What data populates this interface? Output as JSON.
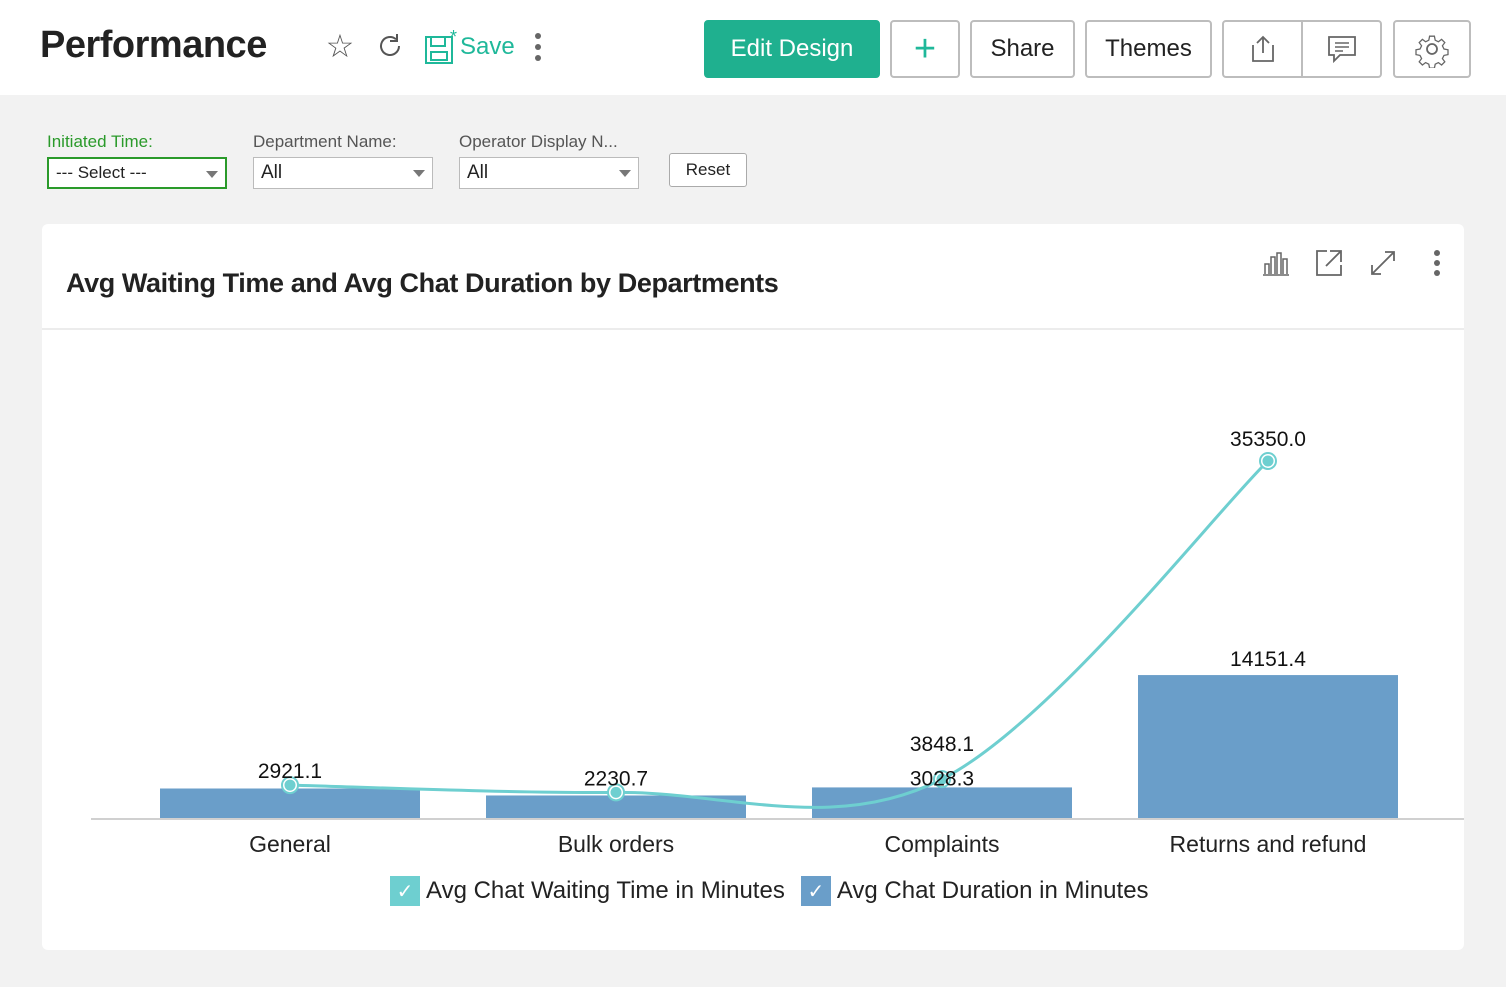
{
  "header": {
    "title": "Performance",
    "save_label": "Save",
    "edit_design_label": "Edit Design",
    "add_label": "+",
    "share_label": "Share",
    "themes_label": "Themes",
    "icons": [
      "star-icon",
      "refresh-icon",
      "save-icon",
      "more-vertical-icon",
      "export-icon",
      "comment-icon",
      "gear-icon"
    ]
  },
  "filters": [
    {
      "label": "Initiated Time:",
      "value": "--- Select ---",
      "active": true
    },
    {
      "label": "Department Name:",
      "value": "All"
    },
    {
      "label": "Operator Display N...",
      "value": "All"
    }
  ],
  "reset_label": "Reset",
  "colors": {
    "accent": "#1fb08f",
    "line_series": "#6ecfd0",
    "bar_series": "#6a9ec9",
    "filter_active": "#2a9a2a"
  },
  "chart_data": {
    "type": "bar",
    "title": "Avg Waiting Time and Avg Chat Duration by Departments",
    "xlabel": "",
    "ylabel": "",
    "categories": [
      "General",
      "Bulk orders",
      "Complaints",
      "Returns and refund"
    ],
    "series": [
      {
        "name": "Avg Chat Waiting Time in Minutes",
        "type": "line",
        "color": "#6ecfd0",
        "values": [
          3260,
          2540,
          3848.1,
          35350.0
        ],
        "labels": [
          "",
          "",
          "3848.1",
          "35350.0"
        ]
      },
      {
        "name": "Avg Chat Duration in Minutes",
        "type": "bar",
        "color": "#6a9ec9",
        "values": [
          2921.1,
          2230.7,
          3028.3,
          14151.4
        ],
        "labels": [
          "2921.1",
          "2230.7",
          "3028.3",
          "14151.4"
        ]
      }
    ],
    "ylim": [
      0,
      40000
    ],
    "grid": false,
    "legend": "bottom-center"
  }
}
